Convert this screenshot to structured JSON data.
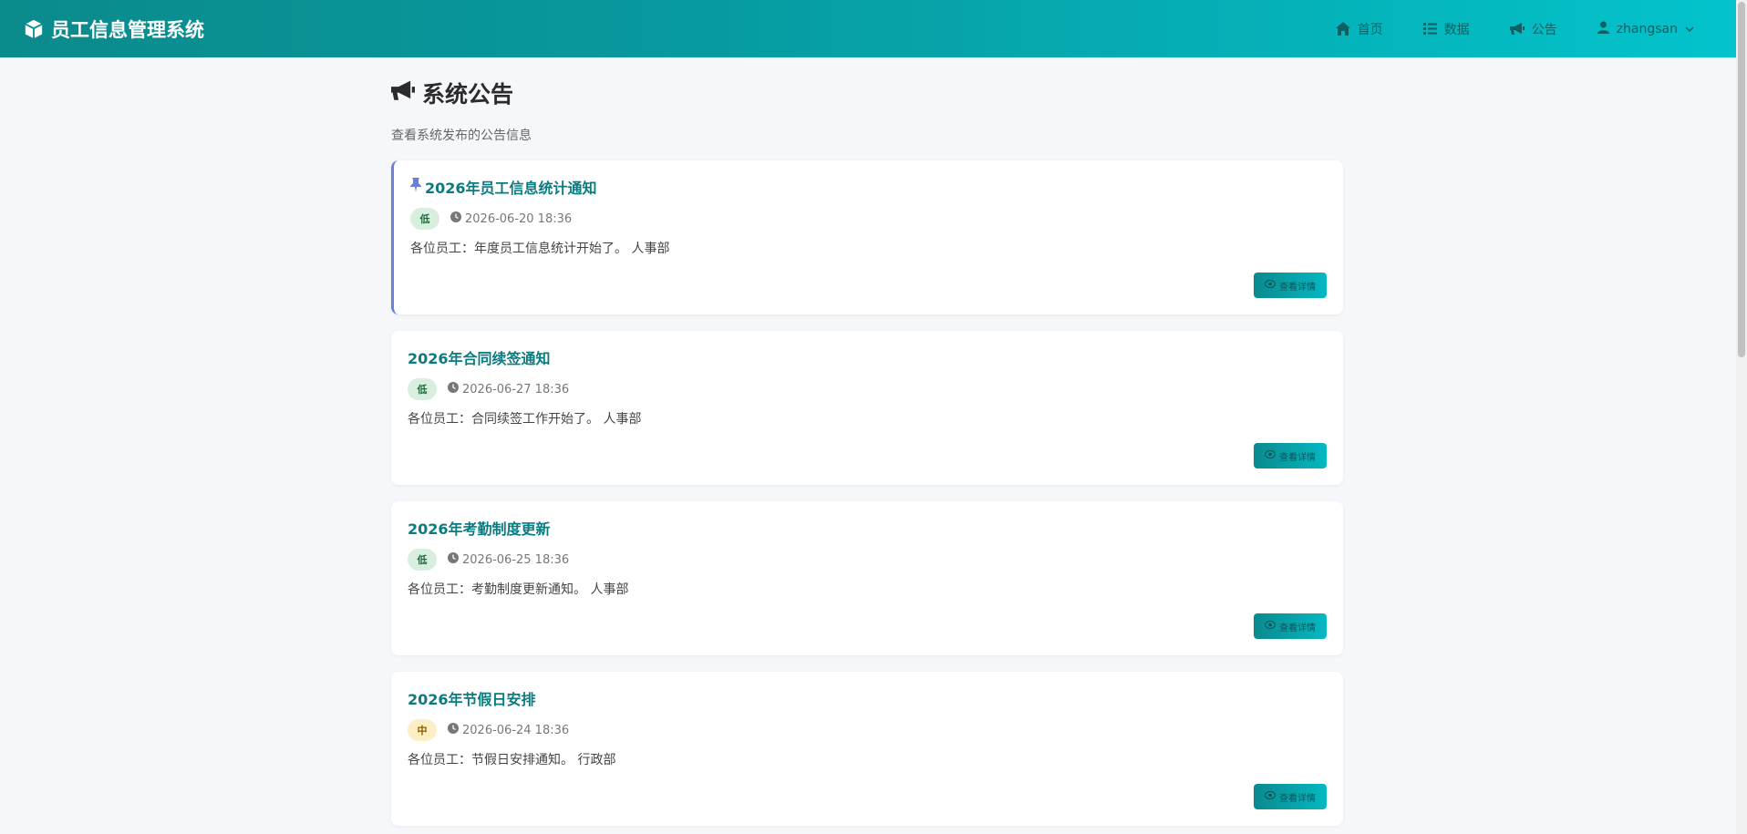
{
  "app": {
    "title": "员工信息管理系统"
  },
  "nav": {
    "home": "首页",
    "data": "数据",
    "notice": "公告",
    "username": "zhangsan"
  },
  "page": {
    "title": "系统公告",
    "subtitle": "查看系统发布的公告信息"
  },
  "view_button_label": "查看详情",
  "announcements": [
    {
      "title": "2026年员工信息统计通知",
      "priority": "低",
      "time": "2026-06-20 18:36",
      "content": "各位员工：年度员工信息统计开始了。 人事部"
    },
    {
      "title": "2026年合同续签通知",
      "priority": "低",
      "time": "2026-06-27 18:36",
      "content": "各位员工：合同续签工作开始了。 人事部"
    },
    {
      "title": "2026年考勤制度更新",
      "priority": "低",
      "time": "2026-06-25 18:36",
      "content": "各位员工：考勤制度更新通知。 人事部"
    },
    {
      "title": "2026年节假日安排",
      "priority": "中",
      "time": "2026-06-24 18:36",
      "content": "各位员工：节假日安排通知。 行政部"
    }
  ],
  "colors": {
    "brand": "#079a9f",
    "title": "#0b7b7f",
    "pinned_border": "#6c7fd8",
    "priority_low_bg": "#d8efe0",
    "priority_mid_bg": "#fcefc4"
  }
}
